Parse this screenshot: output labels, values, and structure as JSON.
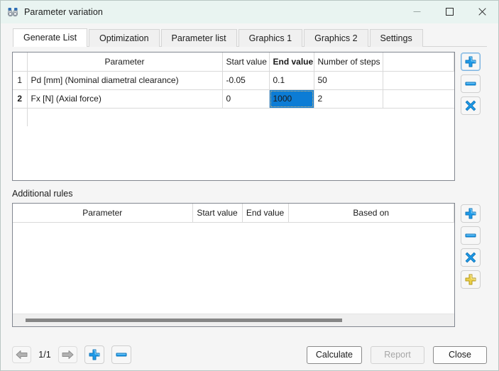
{
  "window": {
    "title": "Parameter variation",
    "icon": "binoculars-icon",
    "minimize_label": "—",
    "maximize_label": "☐",
    "close_label": "✕",
    "titlebar_color": "#e9f4f1"
  },
  "tabs": [
    {
      "label": "Generate List",
      "active": true
    },
    {
      "label": "Optimization",
      "active": false
    },
    {
      "label": "Parameter list",
      "active": false
    },
    {
      "label": "Graphics 1",
      "active": false
    },
    {
      "label": "Graphics 2",
      "active": false
    },
    {
      "label": "Settings",
      "active": false
    }
  ],
  "main_grid": {
    "headers": {
      "rownum": "",
      "parameter": "Parameter",
      "start_value": "Start value",
      "end_value": "End value",
      "number_of_steps": "Number of steps"
    },
    "bold_header": "End value",
    "rows": [
      {
        "num": "1",
        "parameter": "Pd [mm]  (Nominal diametral clearance)",
        "start_value": "-0.05",
        "end_value": "0.1",
        "number_of_steps": "50",
        "selected_row": false,
        "selected_cell": null
      },
      {
        "num": "2",
        "parameter": "Fx [N]  (Axial force)",
        "start_value": "0",
        "end_value": "1000",
        "number_of_steps": "2",
        "selected_row": true,
        "selected_cell": "end_value"
      }
    ],
    "selection_color": "#0c7cd5",
    "focus_border_color": "#f0c070"
  },
  "main_grid_buttons": [
    {
      "name": "add-parameter-button",
      "icon": "plus-blue-icon",
      "focused": true
    },
    {
      "name": "remove-parameter-button",
      "icon": "minus-blue-icon",
      "focused": false
    },
    {
      "name": "delete-all-parameters-button",
      "icon": "x-blue-icon",
      "focused": false
    }
  ],
  "additional_rules": {
    "label": "Additional rules",
    "headers": {
      "parameter": "Parameter",
      "start_value": "Start value",
      "end_value": "End value",
      "based_on": "Based on"
    },
    "rows": [],
    "scrollbar": {
      "visible": true,
      "thumb_percent": 72
    }
  },
  "rules_buttons": [
    {
      "name": "add-rule-button",
      "icon": "plus-blue-icon"
    },
    {
      "name": "remove-rule-button",
      "icon": "minus-blue-icon"
    },
    {
      "name": "delete-all-rules-button",
      "icon": "x-blue-icon"
    },
    {
      "name": "add-special-rule-button",
      "icon": "plus-yellow-icon"
    }
  ],
  "bottom": {
    "prev_icon": "arrow-left-icon",
    "next_icon": "arrow-right-icon",
    "page_indicator": "1/1",
    "add_page_icon": "plus-blue-icon",
    "remove_page_icon": "minus-blue-icon",
    "calculate_label": "Calculate",
    "report_label": "Report",
    "report_disabled": true,
    "close_label": "Close"
  }
}
